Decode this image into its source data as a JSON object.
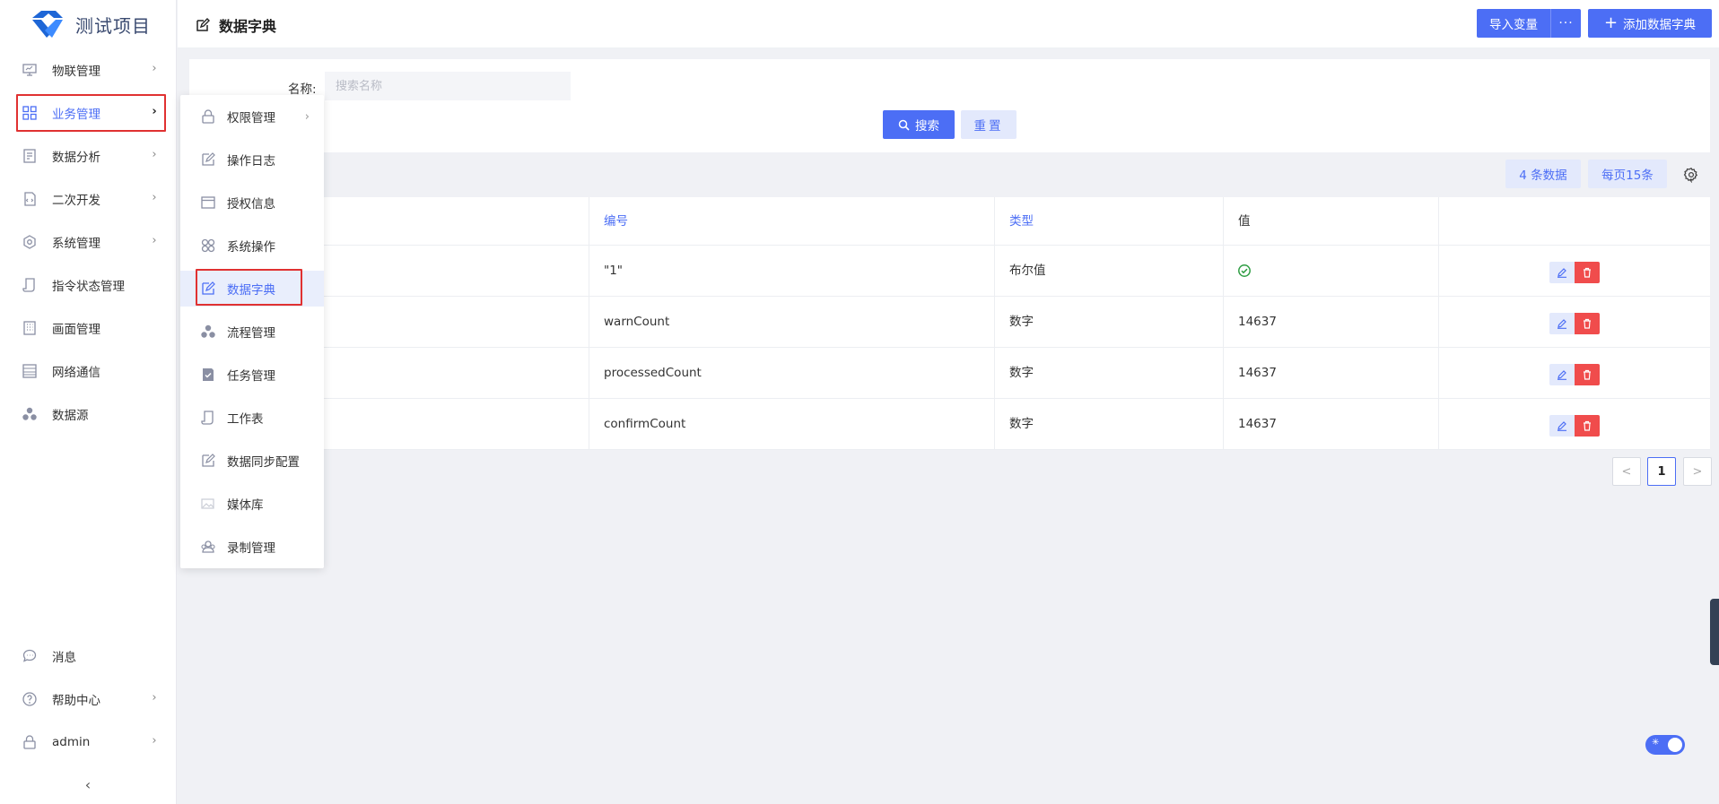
{
  "app": {
    "title": "测试项目"
  },
  "page": {
    "title": "数据字典"
  },
  "sidebar": {
    "items": [
      {
        "label": "物联管理",
        "icon": "monitor-icon"
      },
      {
        "label": "业务管理",
        "icon": "grid-icon"
      },
      {
        "label": "数据分析",
        "icon": "report-icon"
      },
      {
        "label": "二次开发",
        "icon": "code-doc-icon"
      },
      {
        "label": "系统管理",
        "icon": "gear-icon"
      },
      {
        "label": "指令状态管理",
        "icon": "scroll-icon"
      },
      {
        "label": "画面管理",
        "icon": "building-icon"
      },
      {
        "label": "网络通信",
        "icon": "list-icon"
      },
      {
        "label": "数据源",
        "icon": "cluster-icon"
      }
    ],
    "bottom": [
      {
        "label": "消息",
        "icon": "chat-icon"
      },
      {
        "label": "帮助中心",
        "icon": "help-icon"
      },
      {
        "label": "admin",
        "icon": "lock-icon"
      }
    ]
  },
  "submenu": {
    "items": [
      {
        "label": "权限管理"
      },
      {
        "label": "操作日志"
      },
      {
        "label": "授权信息"
      },
      {
        "label": "系统操作"
      },
      {
        "label": "数据字典"
      },
      {
        "label": "流程管理"
      },
      {
        "label": "任务管理"
      },
      {
        "label": "工作表"
      },
      {
        "label": "数据同步配置"
      },
      {
        "label": "媒体库"
      },
      {
        "label": "录制管理"
      }
    ]
  },
  "toolbar": {
    "import_label": "导入变量",
    "more_label": "···",
    "add_label": "添加数据字典"
  },
  "search": {
    "name_label": "名称:",
    "placeholder": "搜索名称",
    "value": "",
    "search_label": "搜索",
    "reset_label": "重置"
  },
  "table": {
    "count_label": "4 条数据",
    "per_page_label": "每页15条",
    "headers": {
      "code": "编号",
      "type": "类型",
      "value": "值"
    },
    "rows": [
      {
        "code": "\"1\"",
        "type": "布尔值",
        "value": "",
        "value_icon": "check-circle-icon"
      },
      {
        "code": "warnCount",
        "type": "数字",
        "value": "14637"
      },
      {
        "code": "processedCount",
        "type": "数字",
        "value": "14637"
      },
      {
        "code": "confirmCount",
        "type": "数字",
        "value": "14637"
      }
    ]
  },
  "pagination": {
    "current": "1",
    "prev": "<",
    "next": ">"
  },
  "colors": {
    "primary": "#4c6ef5",
    "danger": "#f04c4c",
    "highlight": "#e03131",
    "success": "#2f9e44"
  }
}
